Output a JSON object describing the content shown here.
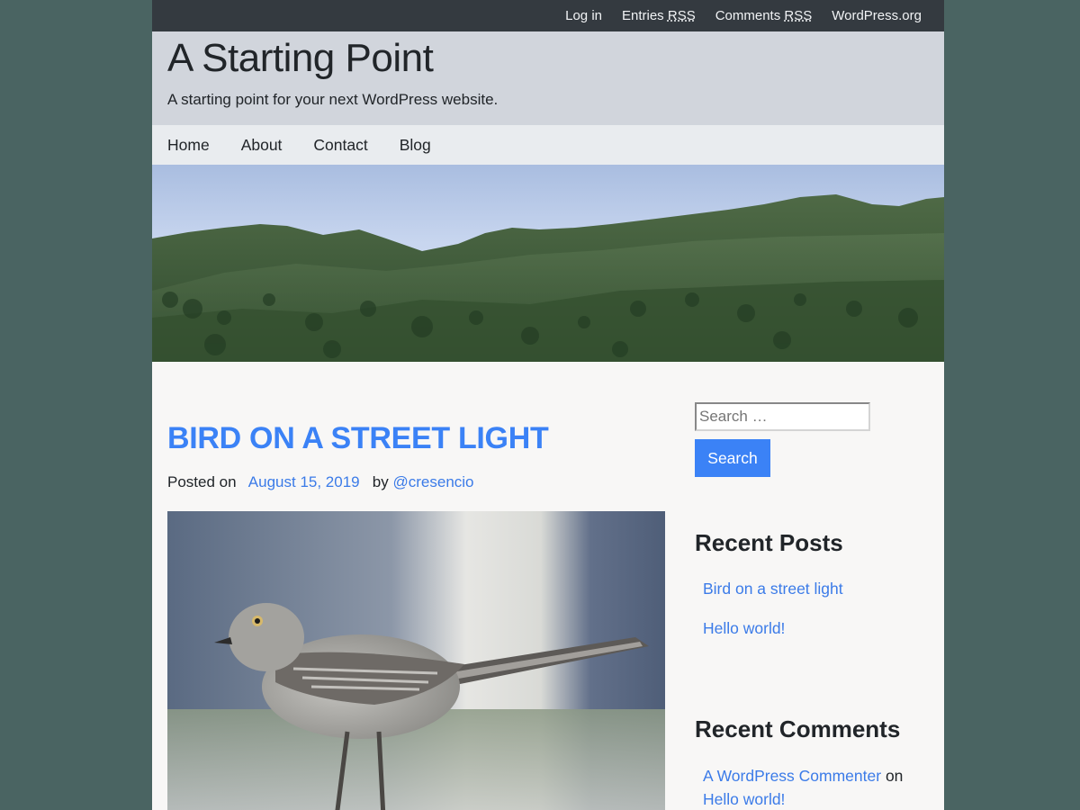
{
  "topbar": {
    "login": "Log in",
    "entries_prefix": "Entries ",
    "entries_abbr": "RSS",
    "comments_prefix": "Comments ",
    "comments_abbr": "RSS",
    "wordpress": "WordPress.org"
  },
  "header": {
    "title": "A Starting Point",
    "description": "A starting point for your next WordPress website."
  },
  "nav": {
    "items": [
      {
        "label": "Home"
      },
      {
        "label": "About"
      },
      {
        "label": "Contact"
      },
      {
        "label": "Blog"
      }
    ]
  },
  "post": {
    "title": "BIRD ON A STREET LIGHT",
    "posted_on_label": "Posted on",
    "date": "August 15, 2019",
    "by_label": "by",
    "author": "@cresencio"
  },
  "sidebar": {
    "search": {
      "placeholder": "Search …",
      "button_label": "Search"
    },
    "recent_posts": {
      "title": "Recent Posts",
      "items": [
        {
          "label": "Bird on a street light"
        },
        {
          "label": "Hello world!"
        }
      ]
    },
    "recent_comments": {
      "title": "Recent Comments",
      "items": [
        {
          "author": "A WordPress Commenter",
          "on_label": "on",
          "post": "Hello world!"
        }
      ]
    }
  },
  "colors": {
    "background": "#4a6462",
    "topbar": "#343a40",
    "header": "#d1d5dc",
    "nav": "#e9ecef",
    "accent": "#3b82f6",
    "link": "#3b7be8"
  },
  "icons": {
    "banner": "mountain-landscape-photo",
    "post_image": "mockingbird-photo"
  }
}
